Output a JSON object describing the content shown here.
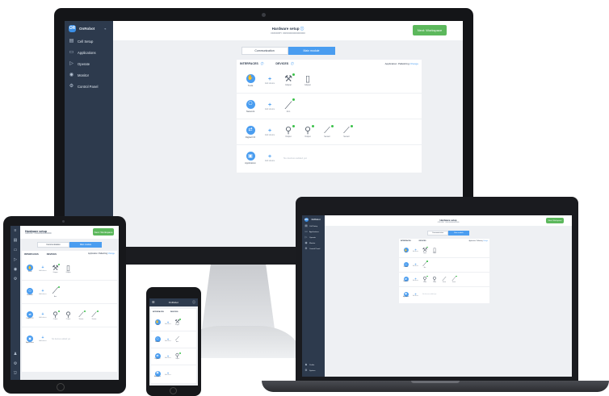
{
  "app": {
    "brand": "OnRobot",
    "brand_logo": "OR",
    "collapse_icon": "«",
    "nav": [
      {
        "label": "Cell Setup",
        "icon": "document-icon",
        "glyph": "▤"
      },
      {
        "label": "Applications",
        "icon": "folder-icon",
        "glyph": "▭"
      },
      {
        "label": "Operate",
        "icon": "play-icon",
        "glyph": "▷"
      },
      {
        "label": "Monitor",
        "icon": "eye-icon",
        "glyph": "◉"
      },
      {
        "label": "Control Panel",
        "icon": "sliders-icon",
        "glyph": "⚙"
      }
    ],
    "nav_bottom": [
      {
        "label": "Profile",
        "icon": "user-icon",
        "glyph": "♟"
      },
      {
        "label": "System",
        "icon": "gear-icon",
        "glyph": "⚙"
      }
    ],
    "page_title": "Hardware setup",
    "page_subtitle": "ORD9X8Y OR00000000000000",
    "info_icon": "ⓘ",
    "next_button": "Next: Workspace",
    "tabs": [
      "Communication",
      "Main module"
    ],
    "interfaces_header": "INTERFACES",
    "devices_header": "DEVICES",
    "application_label": "Application:",
    "application_value": "Palletizing",
    "application_link": "Change",
    "add_label": "Add device",
    "plus_glyph": "+",
    "interfaces": [
      {
        "label": "Tools",
        "icon": "tool-icon",
        "glyph": "✋",
        "devices": [
          {
            "label": "Gripper",
            "glyph": "⚒"
          },
          {
            "label": "Gripper",
            "glyph": "▯"
          }
        ]
      },
      {
        "label": "Network",
        "icon": "network-icon",
        "glyph": "⎔",
        "devices": [
          {
            "label": "Arm",
            "glyph": "⟋"
          }
        ]
      },
      {
        "label": "Digital I/O",
        "icon": "io-icon",
        "glyph": "⇄",
        "devices": [
          {
            "label": "Output",
            "glyph": "⚲"
          },
          {
            "label": "Output",
            "glyph": "⚲"
          },
          {
            "label": "Sensor",
            "glyph": "⟋"
          },
          {
            "label": "Sensor",
            "glyph": "⟋"
          }
        ]
      },
      {
        "label": "Application",
        "icon": "application-icon",
        "glyph": "▣",
        "devices": []
      }
    ],
    "empty_message": "No devices added yet",
    "phone_menu": "☰",
    "phone_title": "OnRobot",
    "tablet_nav_glyphs": [
      "≡",
      "▤",
      "▭",
      "▷",
      "◉",
      "⚙"
    ],
    "tablet_bottom_glyphs": [
      "♟",
      "⚙",
      "⎋"
    ]
  }
}
